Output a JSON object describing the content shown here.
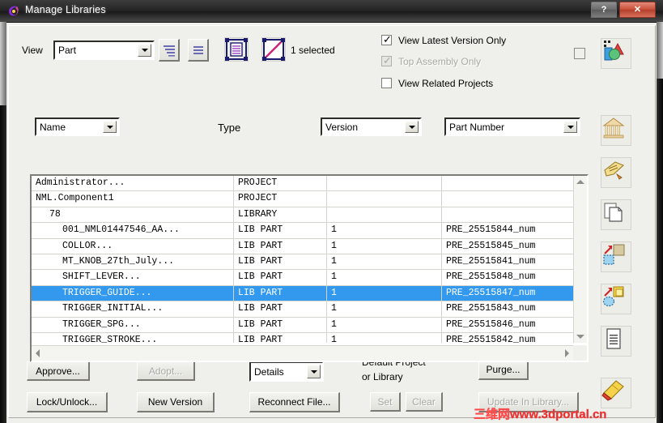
{
  "window": {
    "title": "Manage Libraries",
    "icon": "app-swirl-icon",
    "help_label": "?",
    "close_label": "✕"
  },
  "toolbar": {
    "view_label": "View",
    "view_value": "Part",
    "icon_buttons": [
      {
        "name": "expand-tree-icon",
        "label": ""
      },
      {
        "name": "collapse-tree-icon",
        "label": ""
      },
      {
        "name": "select-all-icon",
        "label": ""
      },
      {
        "name": "deselect-all-icon",
        "label": ""
      }
    ],
    "selection_status": "1 selected",
    "checkboxes": [
      {
        "name": "view-latest-version-only",
        "label": "View Latest Version Only",
        "checked": true,
        "enabled": true
      },
      {
        "name": "top-assembly-only",
        "label": "Top Assembly Only",
        "checked": true,
        "enabled": false
      },
      {
        "name": "view-related-projects",
        "label": "View Related Projects",
        "checked": false,
        "enabled": true
      }
    ],
    "flat_checkbox": {
      "name": "extra-toggle",
      "checked": false
    }
  },
  "filters": {
    "name_value": "Name",
    "type_label": "Type",
    "version_value": "Version",
    "part_number_value": "Part Number"
  },
  "table": {
    "columns": [
      "Name",
      "Type",
      "Version",
      "Part Number"
    ],
    "rows": [
      {
        "name": "Administrator...",
        "type": "PROJECT",
        "version": "",
        "part": "",
        "indent": 0,
        "selected": false
      },
      {
        "name": "NML.Component1",
        "type": "PROJECT",
        "version": "",
        "part": "",
        "indent": 0,
        "selected": false
      },
      {
        "name": "78",
        "type": "LIBRARY",
        "version": "",
        "part": "",
        "indent": 1,
        "selected": false
      },
      {
        "name": "001_NML01447546_AA...",
        "type": "LIB PART",
        "version": "1",
        "part": "PRE_25515844_num",
        "indent": 2,
        "selected": false
      },
      {
        "name": "COLLOR...",
        "type": "LIB PART",
        "version": "1",
        "part": "PRE_25515845_num",
        "indent": 2,
        "selected": false
      },
      {
        "name": "MT_KNOB_27th_July...",
        "type": "LIB PART",
        "version": "1",
        "part": "PRE_25515841_num",
        "indent": 2,
        "selected": false
      },
      {
        "name": "SHIFT_LEVER...",
        "type": "LIB PART",
        "version": "1",
        "part": "PRE_25515848_num",
        "indent": 2,
        "selected": false
      },
      {
        "name": "TRIGGER_GUIDE...",
        "type": "LIB PART",
        "version": "1",
        "part": "PRE_25515847_num",
        "indent": 2,
        "selected": true
      },
      {
        "name": "TRIGGER_INITIAL...",
        "type": "LIB PART",
        "version": "1",
        "part": "PRE_25515843_num",
        "indent": 2,
        "selected": false
      },
      {
        "name": "TRIGGER_SPG...",
        "type": "LIB PART",
        "version": "1",
        "part": "PRE_25515846_num",
        "indent": 2,
        "selected": false
      },
      {
        "name": "TRIGGER_STROKE...",
        "type": "LIB PART",
        "version": "1",
        "part": "PRE_25515842_num",
        "indent": 2,
        "selected": false
      }
    ],
    "selection_color": "#3399ee"
  },
  "actions": {
    "approve": "Approve...",
    "adopt": "Adopt...",
    "details": "Details",
    "lock_unlock": "Lock/Unlock...",
    "new_version": "New Version",
    "reconnect_file": "Reconnect File...",
    "default_project_line1": "Default Project",
    "default_project_line2": "or Library",
    "set": "Set",
    "clear": "Clear",
    "purge": "Purge...",
    "update_in_library": "Update In Library..."
  },
  "sidebar": {
    "items": [
      {
        "name": "new-project-icon",
        "tip": ""
      },
      {
        "name": "library-icon",
        "tip": ""
      },
      {
        "name": "rename-tag-icon",
        "tip": ""
      },
      {
        "name": "copy-icon",
        "tip": ""
      },
      {
        "name": "export-to-box-icon",
        "tip": ""
      },
      {
        "name": "import-from-box-icon",
        "tip": ""
      },
      {
        "name": "report-document-icon",
        "tip": ""
      },
      {
        "name": "eraser-icon",
        "tip": ""
      }
    ]
  },
  "watermark": {
    "text": "三维网www.3dportal.cn"
  }
}
